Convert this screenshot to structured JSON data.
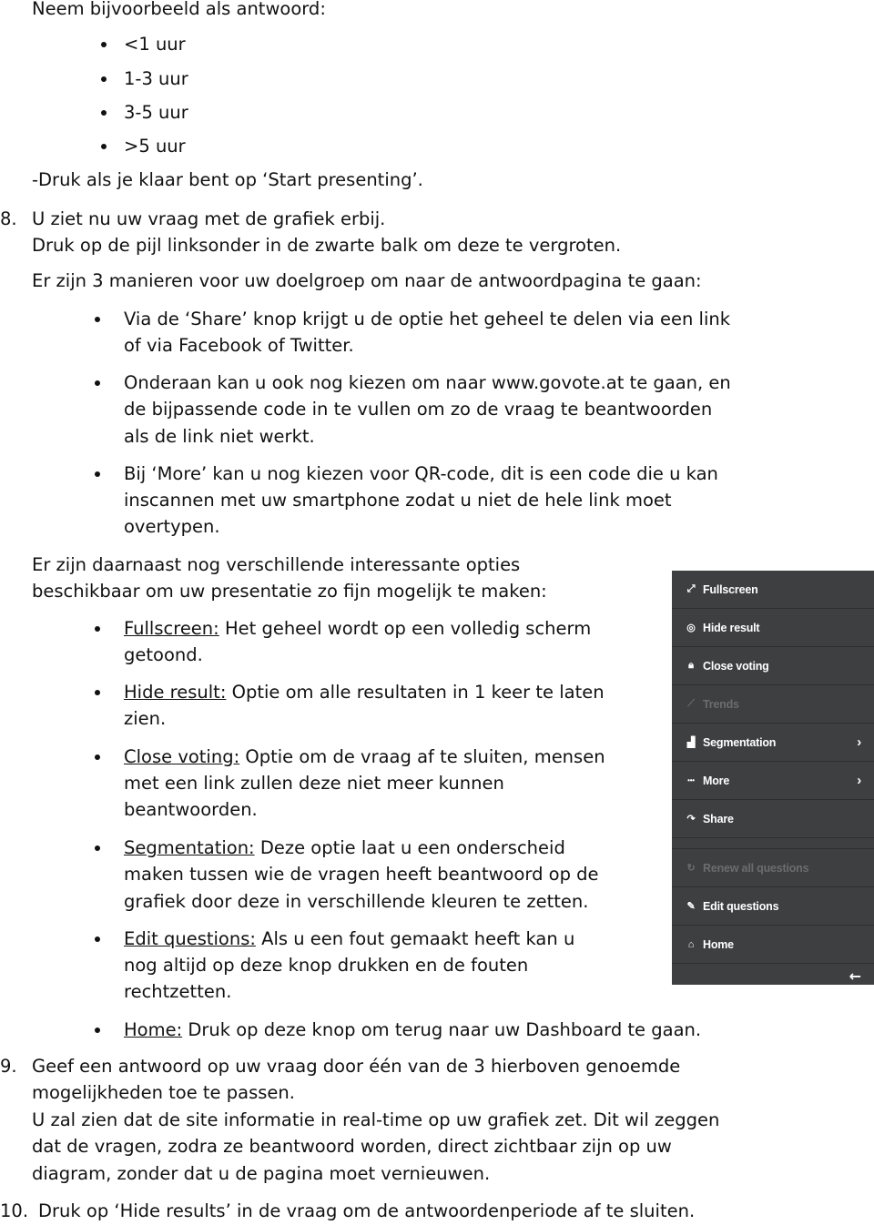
{
  "doc": {
    "intro_line": "Neem bijvoorbeeld als antwoord:",
    "answer_options": [
      "<1 uur",
      "1-3 uur",
      "3-5 uur",
      ">5 uur"
    ],
    "start_presenting": "-Druk als je klaar bent op ‘Start presenting’.",
    "step8": {
      "number": "8.",
      "line1": "U ziet nu uw vraag met de grafiek erbij.",
      "line2": "Druk op de pijl linksonder in de zwarte balk om deze te vergroten."
    },
    "ways_intro": "Er zijn 3 manieren voor uw doelgroep om naar de antwoordpagina te gaan:",
    "ways": [
      [
        "Via de ‘Share’ knop krijgt u de optie het geheel te delen via een link",
        "of via Facebook of Twitter."
      ],
      [
        "Onderaan kan u ook nog kiezen om naar www.govote.at te gaan, en",
        "de bijpassende code in te vullen om zo de vraag te beantwoorden",
        "als de link niet werkt."
      ],
      [
        "Bij ‘More’ kan u nog kiezen voor QR-code, dit is een code die u kan",
        "inscannen met uw smartphone zodat u niet de hele link moet",
        "overtypen."
      ]
    ],
    "options_intro": [
      "Er zijn daarnaast nog verschillende interessante opties",
      "beschikbaar om uw presentatie zo fijn mogelijk te maken:"
    ],
    "options": [
      {
        "term": "Fullscreen:",
        "lines": [
          " Het geheel wordt op een volledig scherm",
          "getoond."
        ]
      },
      {
        "term": "Hide result:",
        "lines": [
          " Optie om alle resultaten in 1 keer te laten",
          "zien."
        ]
      },
      {
        "term": "Close voting:",
        "lines": [
          " Optie om de vraag af te sluiten, mensen",
          "met een link zullen deze niet meer kunnen",
          "beantwoorden."
        ]
      },
      {
        "term": "Segmentation:",
        "lines": [
          " Deze optie laat u een onderscheid",
          "maken tussen wie de vragen heeft beantwoord op de",
          "grafiek door deze in verschillende kleuren te zetten."
        ]
      },
      {
        "term": "Edit questions:",
        "lines": [
          " Als u een fout gemaakt heeft kan u",
          "nog altijd op deze knop drukken en de fouten",
          "rechtzetten."
        ]
      },
      {
        "term": "Home:",
        "lines": [
          " Druk op deze knop om terug naar uw Dashboard te gaan."
        ]
      }
    ],
    "step9": {
      "number": "9.",
      "lines": [
        "Geef een antwoord op uw vraag door één van de 3 hierboven genoemde",
        "mogelijkheden toe te passen.",
        "U zal zien dat de site informatie in real-time op uw grafiek zet. Dit wil zeggen",
        "dat de vragen, zodra ze beantwoord worden, direct zichtbaar zijn op uw",
        "diagram, zonder dat u de pagina moet vernieuwen."
      ]
    },
    "step10": {
      "number": "10.",
      "line": "Druk op ‘Hide results’ in de vraag om de antwoordenperiode af te sluiten."
    }
  },
  "menu_panel": {
    "background": "#3e3f41",
    "items": [
      {
        "label": "Fullscreen",
        "icon": "expand-icon",
        "glyph": "⤢",
        "disabled": false,
        "submenu": false
      },
      {
        "label": "Hide result",
        "icon": "eye-slash-icon",
        "glyph": "◎",
        "disabled": false,
        "submenu": false
      },
      {
        "label": "Close voting",
        "icon": "lock-icon",
        "glyph": "🔒︎",
        "disabled": false,
        "submenu": false
      },
      {
        "label": "Trends",
        "icon": "trend-chart-icon",
        "glyph": "⟋",
        "disabled": true,
        "submenu": false
      },
      {
        "label": "Segmentation",
        "icon": "segment-chart-icon",
        "glyph": "▟",
        "disabled": false,
        "submenu": true
      },
      {
        "label": "More",
        "icon": "more-dots-icon",
        "glyph": "•••",
        "disabled": false,
        "submenu": true
      },
      {
        "label": "Share",
        "icon": "share-arrow-icon",
        "glyph": "↷",
        "disabled": false,
        "submenu": false
      },
      {
        "label": "Renew all questions",
        "icon": "refresh-icon",
        "glyph": "↻",
        "disabled": true,
        "submenu": false
      },
      {
        "label": "Edit questions",
        "icon": "edit-icon",
        "glyph": "✎",
        "disabled": false,
        "submenu": false
      },
      {
        "label": "Home",
        "icon": "home-icon",
        "glyph": "⌂",
        "disabled": false,
        "submenu": false
      }
    ],
    "chevron_glyph": "›",
    "back_glyph": "←"
  }
}
